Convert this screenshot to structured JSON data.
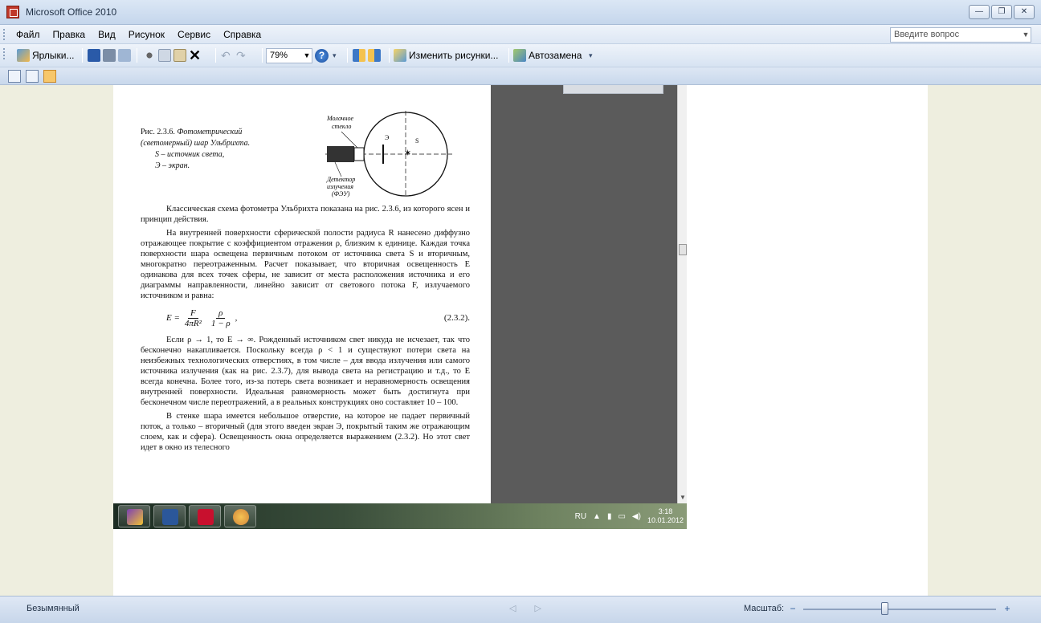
{
  "window": {
    "title": "Microsoft Office 2010",
    "controls": [
      "—",
      "❐",
      "✕"
    ]
  },
  "menu": {
    "items": [
      {
        "label": "Файл"
      },
      {
        "label": "Правка"
      },
      {
        "label": "Вид"
      },
      {
        "label": "Рисунок"
      },
      {
        "label": "Сервис"
      },
      {
        "label": "Справка"
      }
    ],
    "ask_placeholder": "Введите вопрос"
  },
  "toolbar": {
    "shortcuts_label": "Ярлыки...",
    "zoom_value": "79%",
    "help_glyph": "?",
    "edit_pictures_label": "Изменить рисунки...",
    "autoreplace_label": "Автозамена"
  },
  "document": {
    "diagram_labels": {
      "milk_glass_1": "Молочное",
      "milk_glass_2": "стекло",
      "e": "Э",
      "s": "S",
      "detector_1": "Детектор",
      "detector_2": "излучения",
      "detector_3": "(ФЭУ)"
    },
    "caption_lead": "Рис. 2.3.6.",
    "caption_title": "Фотометрический (светомерный) шар Ульбрихта.",
    "caption_s": "S – источник света,",
    "caption_e": "Э – экран.",
    "p1": "Классическая схема фотометра Ульбрихта показана на рис. 2.3.6, из которого ясен и принцип действия.",
    "p2": "На внутренней поверхности сферической полости радиуса R нанесено диффузно отражающее покрытие с коэффициентом отражения ρ, близким к единице. Каждая точка поверхности шара освещена первичным потоком от источника света S и вторичным, многократно переотраженным. Расчет показывает, что вторичная освещенность E одинакова для всех точек сферы, не зависит от места расположения источника и его диаграммы направленности, линейно зависит от светового потока F, излучаемого источником и равна:",
    "formula": {
      "lhs": "E =",
      "num1": "F",
      "den1": "4πR²",
      "num2": "ρ",
      "den2": "1 − ρ",
      "tail": ",",
      "number": "(2.3.2)."
    },
    "p3": "Если ρ → 1, то E → ∞. Рожденный источником свет никуда не исчезает, так что бесконечно накапливается. Поскольку всегда ρ < 1 и существуют потери света на неизбежных технологических отверстиях, в том числе – для ввода излучения или самого источника излучения (как на рис. 2.3.7), для вывода света на регистрацию и т.д., то E всегда конечна. Более того, из-за потерь света возникает и неравномерность освещения внутренней поверхности. Идеальная равномерность может быть достигнута при бесконечном числе переотражений, а в реальных конструкциях оно составляет 10 – 100.",
    "p4": "В стенке шара имеется небольшое отверстие, на которое не падает первичный поток, а только – вторичный (для этого введен экран Э, покрытый таким же отражающим слоем, как и сфера). Освещенность окна определяется выражением (2.3.2). Но этот свет идет в окно из телесного"
  },
  "taskbar": {
    "lang": "RU",
    "tray_arrow": "▲",
    "time": "3:18",
    "date": "10.01.2012"
  },
  "status": {
    "doc_name": "Безымянный",
    "nav": "◁ ▷",
    "zoom_label": "Масштаб:",
    "zoom_minus": "−",
    "zoom_plus": "+",
    "zoom_level": 0.42
  },
  "colors": {
    "accent": "#2d5b9a",
    "canvas": "#eeeedf",
    "dark_panel": "#5b5b5b"
  },
  "icons": [
    "app-icon",
    "shortcut-icon",
    "save-icon",
    "print-icon",
    "preview-icon",
    "cut-icon",
    "copy-icon",
    "paste-icon",
    "delete-icon",
    "undo-icon",
    "redo-icon",
    "help-icon",
    "rotate-left-icon",
    "rotate-right-icon",
    "edit-picture-icon",
    "autoreplace-icon"
  ]
}
